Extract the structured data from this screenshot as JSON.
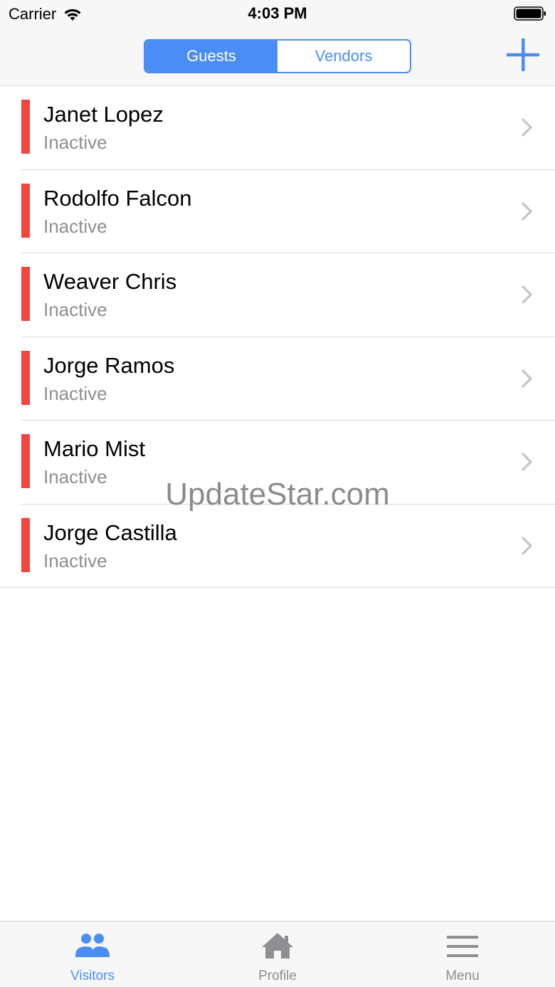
{
  "status_bar": {
    "carrier": "Carrier",
    "time": "4:03 PM"
  },
  "nav": {
    "segments": [
      "Guests",
      "Vendors"
    ],
    "selected_segment": "Guests",
    "add_icon": "plus-icon"
  },
  "visitors": [
    {
      "name": "Janet Lopez",
      "status": "Inactive"
    },
    {
      "name": "Rodolfo Falcon",
      "status": "Inactive"
    },
    {
      "name": "Weaver Chris",
      "status": "Inactive"
    },
    {
      "name": "Jorge Ramos",
      "status": "Inactive"
    },
    {
      "name": "Mario Mist",
      "status": "Inactive"
    },
    {
      "name": "Jorge Castilla",
      "status": "Inactive"
    }
  ],
  "watermark": "UpdateStar.com",
  "tab_bar": {
    "tabs": [
      {
        "label": "Visitors",
        "icon": "people-icon",
        "active": true
      },
      {
        "label": "Profile",
        "icon": "home-icon",
        "active": false
      },
      {
        "label": "Menu",
        "icon": "hamburger-menu-icon",
        "active": false
      }
    ]
  },
  "colors": {
    "accent": "#4a8ef5",
    "inactive_stripe": "#f2453d",
    "secondary_text": "#8e8e93"
  }
}
